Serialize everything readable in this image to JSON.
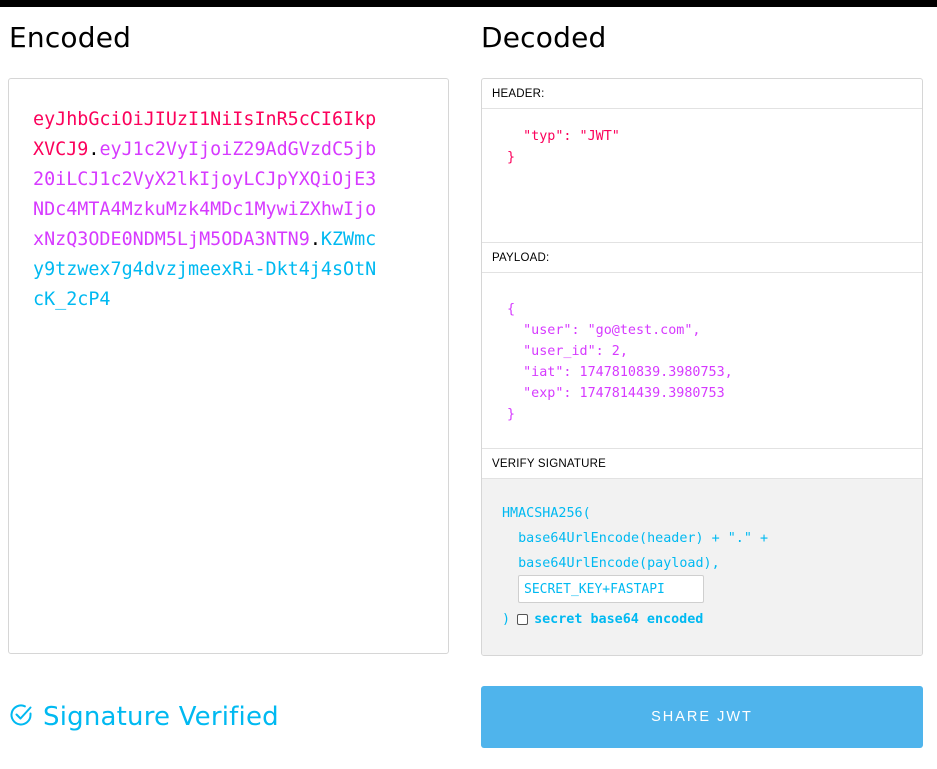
{
  "titles": {
    "encoded": "Encoded",
    "decoded": "Decoded"
  },
  "encoded": {
    "header": "eyJhbGciOiJIUzI1NiIsInR5cCI6IkpXVCJ9",
    "dot1": ".",
    "payload": "eyJ1c2VyIjoiZ29AdGVzdC5jb20iLCJ1c2VyX2lkIjoyLCJpYXQiOjE3NDc4MTA4MzkuMzk4MDc1MywiZXhwIjoxNzQ3ODE0NDM5LjM5ODA3NTN9",
    "dot2": ".",
    "signature": "KZWmcy9tzwex7g4dvzjmeexRi-Dkt4j4sOtNcK_2cP4"
  },
  "decoded": {
    "header_label": "HEADER:",
    "header_lines": [
      "  \"typ\": \"JWT\"",
      "}"
    ],
    "payload_label": "PAYLOAD:",
    "payload_lines": [
      "{",
      "  \"user\": \"go@test.com\",",
      "  \"user_id\": 2,",
      "  \"iat\": 1747810839.3980753,",
      "  \"exp\": 1747814439.3980753",
      "}"
    ],
    "verify_label": "VERIFY SIGNATURE",
    "verify_lines": [
      "HMACSHA256(",
      "  base64UrlEncode(header) + \".\" +",
      "  base64UrlEncode(payload),"
    ],
    "secret_value": "SECRET_KEY+FASTAPI",
    "close_paren": ")",
    "checkbox_label": "secret base64 encoded"
  },
  "status": {
    "text": "Signature Verified",
    "icon": "check-circle-icon"
  },
  "share_button": "SHARE JWT",
  "colors": {
    "header": "#fb015b",
    "payload": "#d63aff",
    "signature": "#00b9f1",
    "button": "#4fb4ec"
  }
}
